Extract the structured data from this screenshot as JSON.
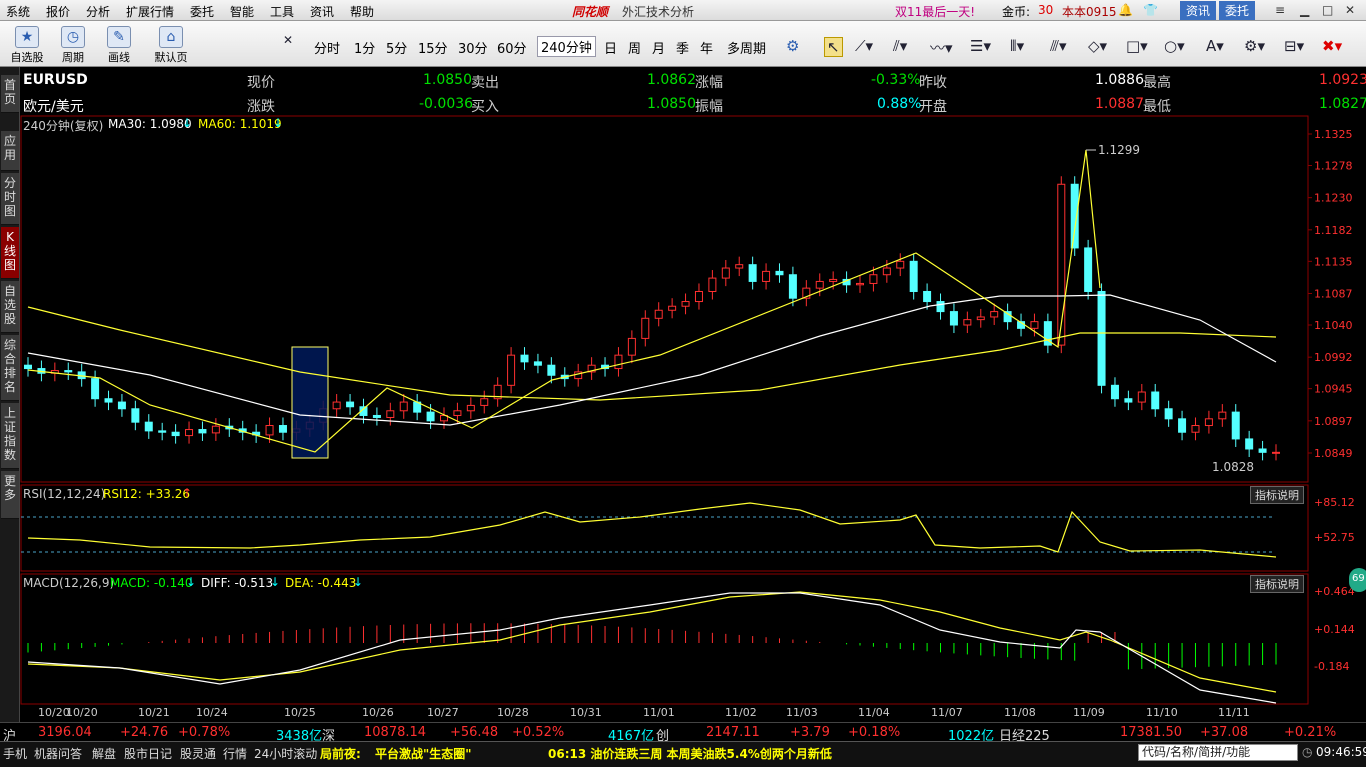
{
  "app": {
    "logo": "同花顺",
    "module": "外汇技术分析",
    "promo": "双11最后一天!",
    "coins_label": "金币:",
    "coins": "30",
    "version": "本本0915",
    "btn_news": "资讯",
    "btn_trade": "委托"
  },
  "menu": [
    "系统",
    "报价",
    "分析",
    "扩展行情",
    "委托",
    "智能",
    "工具",
    "资讯",
    "帮助"
  ],
  "tools": [
    {
      "label": "自选股",
      "icon": "star-icon"
    },
    {
      "label": "周期",
      "icon": "clock-icon"
    },
    {
      "label": "画线",
      "icon": "pen-icon"
    },
    {
      "label": "默认页",
      "icon": "home-icon"
    }
  ],
  "periods": [
    "分时",
    "1分",
    "5分",
    "15分",
    "30分",
    "60分",
    "240分钟",
    "日",
    "周",
    "月",
    "季",
    "年",
    "多周期"
  ],
  "selected_period": "240分钟",
  "sidebar": [
    "首页",
    "应用",
    "分时图",
    "K线图",
    "自选股",
    "综合排名",
    "上证指数",
    "更多"
  ],
  "quote": {
    "symbol": "EURUSD",
    "name": "欧元/美元",
    "l_price": "现价",
    "price": "1.0850",
    "l_change": "涨跌",
    "change": "-0.0036",
    "l_ask": "卖出",
    "ask": "1.0862",
    "l_bid": "买入",
    "bid": "1.0850",
    "l_pct": "涨幅",
    "pct": "-0.33%",
    "l_amp": "振幅",
    "amp": "0.88%",
    "l_prev": "昨收",
    "prev": "1.0886",
    "l_open": "开盘",
    "open": "1.0887",
    "l_high": "最高",
    "high": "1.0923",
    "l_low": "最低",
    "low": "1.0827"
  },
  "kpane": {
    "title": "240分钟(复权)",
    "ma30": "MA30: 1.0980",
    "ma60": "MA60: 1.1019",
    "peak_label": "1.1299",
    "trough_label": "1.0828"
  },
  "rsipane": {
    "title": "RSI(12,12,24)",
    "value": "RSI12: +33.26",
    "btn": "指标说明"
  },
  "macdpane": {
    "title": "MACD(12,26,9)",
    "macd": "MACD: -0.140",
    "diff": "DIFF: -0.513",
    "dea": "DEA: -0.443",
    "btn": "指标说明"
  },
  "chart_data": {
    "type": "candlestick",
    "y_ticks": [
      "1.1325",
      "1.1278",
      "1.1230",
      "1.1182",
      "1.1135",
      "1.1087",
      "1.1040",
      "1.0992",
      "1.0945",
      "1.0897",
      "1.0849"
    ],
    "rsi_ticks": [
      "+85.12",
      "+52.75"
    ],
    "macd_ticks": [
      "+0.464",
      "+0.144",
      "-0.184"
    ],
    "x_labels": [
      "10/20",
      "10/20",
      "10/21",
      "10/24",
      "10/25",
      "10/26",
      "10/27",
      "10/28",
      "10/31",
      "11/01",
      "11/02",
      "11/03",
      "11/04",
      "11/07",
      "11/08",
      "11/09",
      "11/10",
      "11/11"
    ]
  },
  "status": {
    "sh_label": "沪",
    "sh": "3196.04",
    "sh_chg": "+24.76",
    "sh_pct": "+0.78%",
    "sh_vol": "3438亿",
    "sz_label": "深",
    "sz": "10878.14",
    "sz_chg": "+56.48",
    "sz_pct": "+0.52%",
    "sz_vol": "4167亿",
    "cy_label": "创",
    "cy": "2147.11",
    "cy_chg": "+3.79",
    "cy_pct": "+0.18%",
    "cy_vol": "1022亿",
    "nk_label": "日经225",
    "nk": "17381.50",
    "nk_chg": "+37.08",
    "nk_pct": "+0.21%"
  },
  "bottom": {
    "tabs": [
      "手机",
      "机器问答",
      "解盘",
      "股市日记",
      "股灵通",
      "行情",
      "24小时滚动"
    ],
    "news_label": "局前夜:",
    "news1": "平台激战\"生态圈\"",
    "news2": "06:13 油价连跌三周 本周美油跌5.4%创两个月新低",
    "search_placeholder": "代码/名称/简拼/功能",
    "time": "09:46:59"
  }
}
